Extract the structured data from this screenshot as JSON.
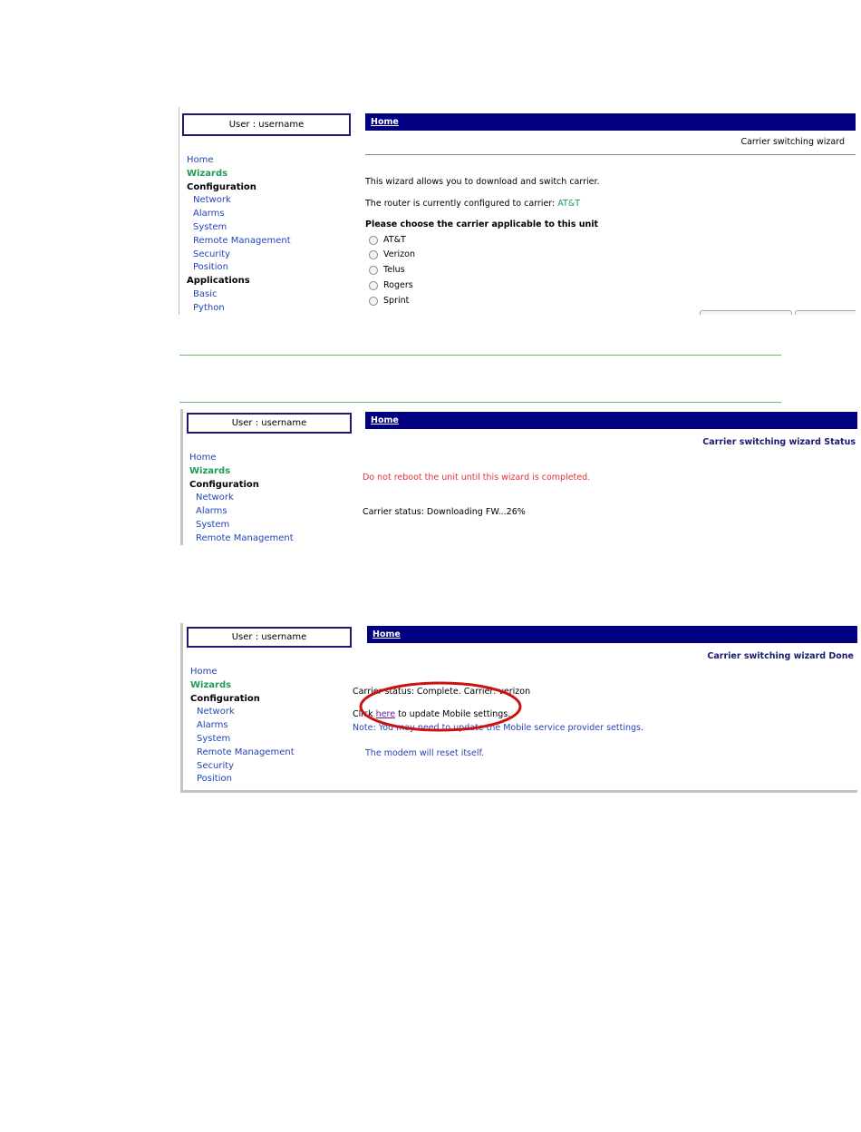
{
  "common": {
    "user_label": "User : username",
    "home_tab": "Home"
  },
  "nav": {
    "home": "Home",
    "wizards": "Wizards",
    "configuration": "Configuration",
    "network": "Network",
    "alarms": "Alarms",
    "system": "System",
    "remote_management": "Remote Management",
    "security": "Security",
    "position": "Position",
    "applications": "Applications",
    "basic": "Basic",
    "python": "Python"
  },
  "screen1": {
    "title": "Carrier switching wizard",
    "intro": "This wizard allows you to download and switch carrier.",
    "current_label": "The router is currently configured to carrier: ",
    "current_value": "AT&T",
    "choose_label": "Please choose the carrier applicable to this unit",
    "carriers": [
      "AT&T",
      "Verizon",
      "Telus",
      "Rogers",
      "Sprint"
    ]
  },
  "screen2": {
    "title": "Carrier switching wizard Status",
    "warning": "Do not reboot the unit until this wizard is completed.",
    "status": "Carrier status: Downloading FW...26%"
  },
  "screen3": {
    "title": "Carrier switching wizard Done",
    "status": "Carrier status: Complete. Carrier: verizon",
    "click_prefix": "Click ",
    "here_link": "here",
    "click_suffix": " to update Mobile settings.",
    "note": "Note: You may need to update the Mobile service provider settings.",
    "reset": "The modem will reset itself."
  },
  "colors": {
    "nav_bar": "#000080",
    "link": "#2244bb",
    "wizards": "#1f9a55",
    "warning": "#e83030",
    "annotation": "#cc1111"
  }
}
